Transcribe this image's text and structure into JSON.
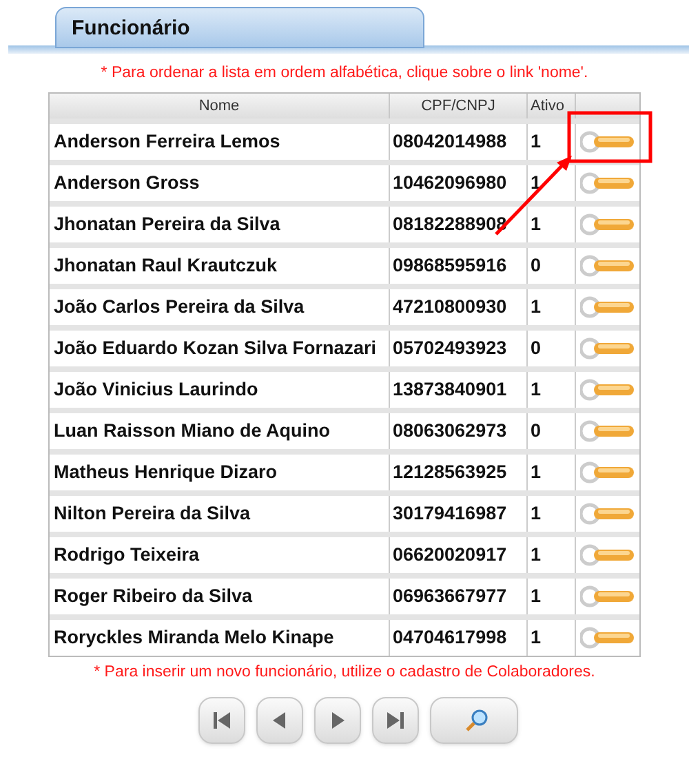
{
  "tab": {
    "title": "Funcionário"
  },
  "sort_note": "* Para ordenar a lista em ordem alfabética, clique sobre o link 'nome'.",
  "table": {
    "columns": [
      "Nome",
      "CPF/CNPJ",
      "Ativo"
    ],
    "rows": [
      {
        "nome": "Anderson Ferreira Lemos",
        "cpf": "08042014988",
        "ativo": "1"
      },
      {
        "nome": "Anderson Gross",
        "cpf": "10462096980",
        "ativo": "1"
      },
      {
        "nome": "Jhonatan Pereira da Silva",
        "cpf": "08182288908",
        "ativo": "1"
      },
      {
        "nome": "Jhonatan Raul Krautczuk",
        "cpf": "09868595916",
        "ativo": "0"
      },
      {
        "nome": "João Carlos Pereira da Silva",
        "cpf": "47210800930",
        "ativo": "1"
      },
      {
        "nome": "João Eduardo Kozan Silva Fornazari",
        "cpf": "05702493923",
        "ativo": "0"
      },
      {
        "nome": "João Vinicius Laurindo",
        "cpf": "13873840901",
        "ativo": "1"
      },
      {
        "nome": "Luan Raisson Miano de Aquino",
        "cpf": "08063062973",
        "ativo": "0"
      },
      {
        "nome": "Matheus Henrique Dizaro",
        "cpf": "12128563925",
        "ativo": "1"
      },
      {
        "nome": "Nilton Pereira da Silva",
        "cpf": "30179416987",
        "ativo": "1"
      },
      {
        "nome": "Rodrigo Teixeira",
        "cpf": "06620020917",
        "ativo": "1"
      },
      {
        "nome": "Roger Ribeiro da Silva",
        "cpf": "06963667977",
        "ativo": "1"
      },
      {
        "nome": "Roryckles Miranda Melo Kinape",
        "cpf": "04704617998",
        "ativo": "1"
      }
    ]
  },
  "insert_note": "* Para inserir um novo funcionário, utilize o cadastro de Colaboradores.",
  "nav_buttons": [
    {
      "kind": "first"
    },
    {
      "kind": "prev"
    },
    {
      "kind": "next"
    },
    {
      "kind": "last"
    },
    {
      "kind": "search"
    }
  ]
}
